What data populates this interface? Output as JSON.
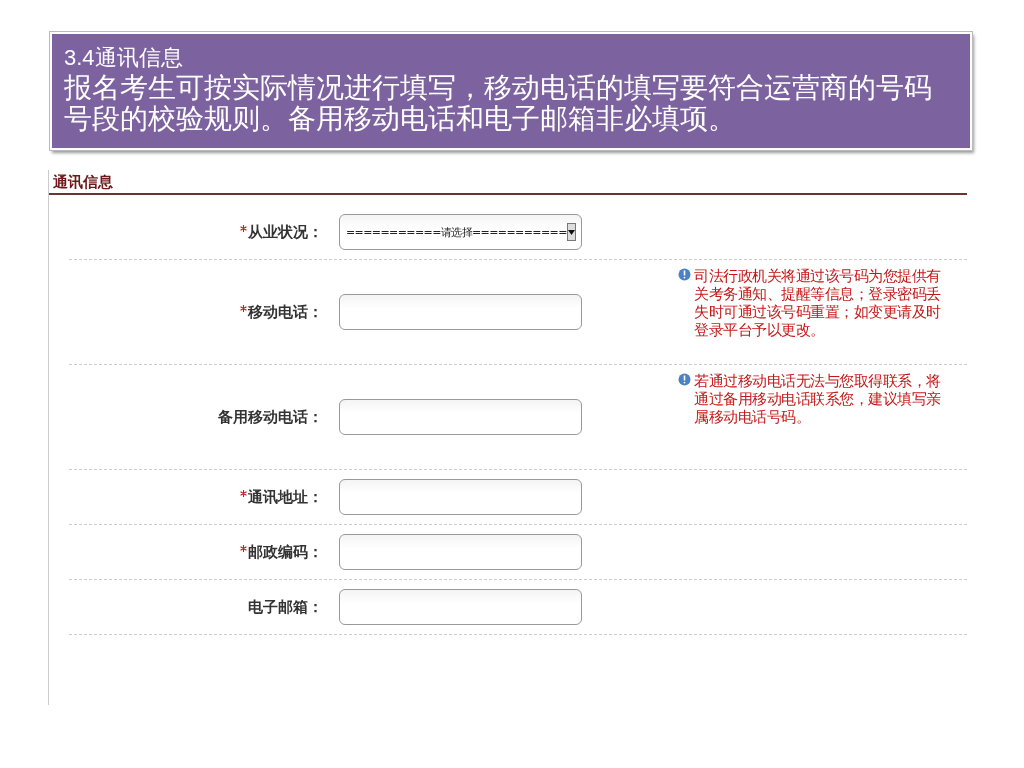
{
  "banner": {
    "title": "3.4通讯信息",
    "lines": [
      "报名考生可按实际情况进行填写，移动电话的填写要符合运营商的号码",
      "号段的校验规则。备用移动电话和电子邮箱非必填项。"
    ]
  },
  "form": {
    "heading": "通讯信息",
    "fields": [
      {
        "kind": "select",
        "label": "从业状况：",
        "required": true,
        "value": "===========请选择==========="
      },
      {
        "kind": "text",
        "label": "移动电话：",
        "required": true,
        "hint": "司法行政机关将通过该号码为您提供有关考务通知、提醒等信息；登录密码丢失时可通过该号码重置；如变更请及时登录平台予以更改。"
      },
      {
        "kind": "text",
        "label": "备用移动电话：",
        "required": false,
        "hint": "若通过移动电话无法与您取得联系，将通过备用移动电话联系您，建议填写亲属移动电话号码。"
      },
      {
        "kind": "text",
        "label": "通讯地址：",
        "required": true
      },
      {
        "kind": "text",
        "label": "邮政编码：",
        "required": true
      },
      {
        "kind": "text",
        "label": "电子邮箱：",
        "required": false
      }
    ]
  }
}
